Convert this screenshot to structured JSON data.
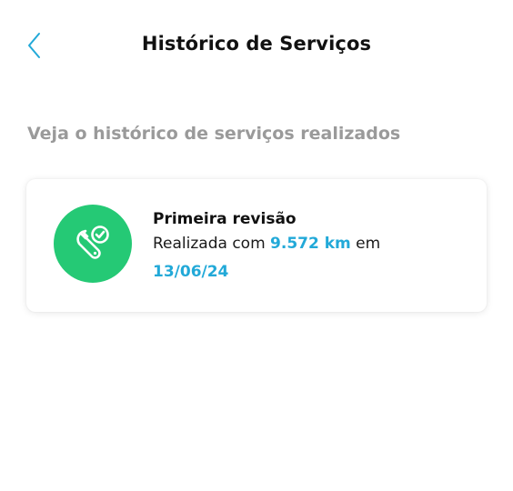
{
  "header": {
    "title": "Histórico de Serviços",
    "back_icon": "chevron-left-icon"
  },
  "subtitle": "Veja o histórico de serviços realizados",
  "services": [
    {
      "title": "Primeira revisão",
      "prefix": "Realizada com",
      "mileage": "9.572 km",
      "connector": "em",
      "date": "13/06/24",
      "icon": "wrench-check-icon"
    }
  ],
  "colors": {
    "accent": "#22a9d8",
    "icon_background": "#25c975",
    "subtitle": "#9a9a9a"
  }
}
